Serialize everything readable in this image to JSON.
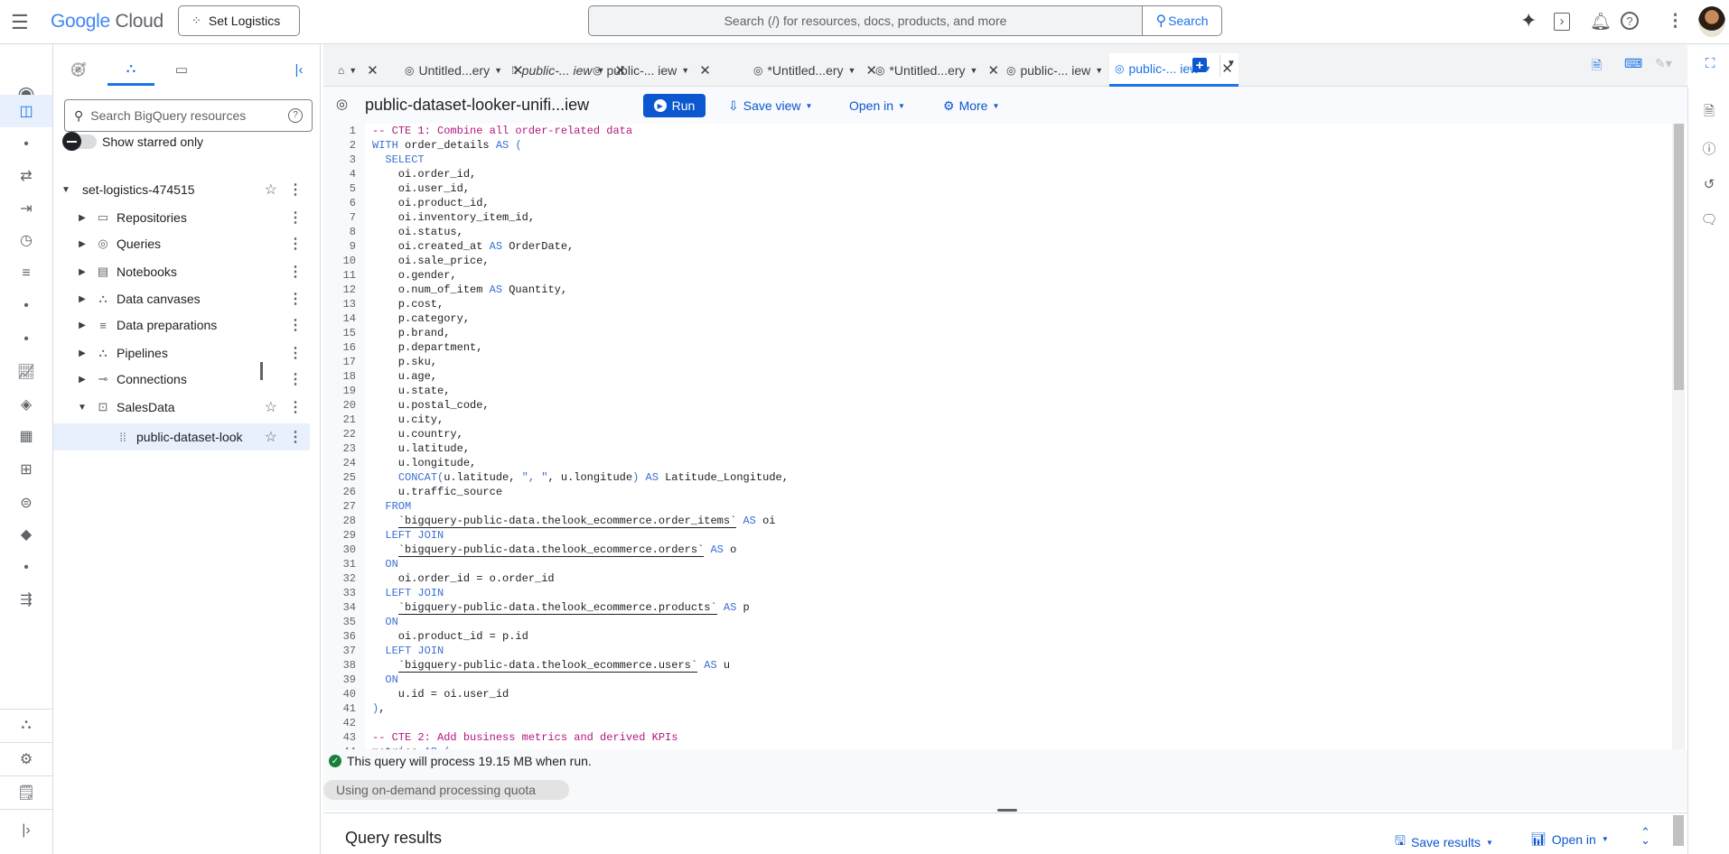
{
  "header": {
    "logo": {
      "google": "Google",
      "cloud": "Cloud"
    },
    "project": "Set Logistics",
    "search_placeholder": "Search (/) for resources, docs, products, and more",
    "search_button": "Search"
  },
  "explorer": {
    "search_placeholder": "Search BigQuery resources",
    "show_starred": "Show starred only",
    "tree": [
      {
        "label": "set-logistics-474515",
        "icon": "project",
        "expanded": true
      },
      {
        "label": "Repositories",
        "icon": "repo"
      },
      {
        "label": "Queries",
        "icon": "query"
      },
      {
        "label": "Notebooks",
        "icon": "notebook"
      },
      {
        "label": "Data canvases",
        "icon": "canvas"
      },
      {
        "label": "Data preparations",
        "icon": "prep"
      },
      {
        "label": "Pipelines",
        "icon": "pipeline"
      },
      {
        "label": "Connections",
        "icon": "connection"
      },
      {
        "label": "SalesData",
        "icon": "dataset",
        "expanded": true
      },
      {
        "label": "public-dataset-look",
        "icon": "view",
        "selected": true
      }
    ]
  },
  "tabs": [
    {
      "label": "",
      "icon": "home"
    },
    {
      "label": "Untitled...ery",
      "icon": "query"
    },
    {
      "label": "public-... iew",
      "icon": "view",
      "italic": true
    },
    {
      "label": "public-... iew",
      "icon": "query"
    },
    {
      "label": "*Untitled...ery",
      "icon": "query"
    },
    {
      "label": "*Untitled...ery",
      "icon": "query"
    },
    {
      "label": "public-... iew",
      "icon": "query"
    },
    {
      "label": "public-... iew",
      "icon": "query",
      "active": true
    }
  ],
  "toolbar": {
    "title": "public-dataset-looker-unifi...iew",
    "run": "Run",
    "save_view": "Save view",
    "open_in": "Open in",
    "more": "More"
  },
  "code_lines": [
    [
      [
        "cm",
        "-- CTE 1: Combine all order-related data"
      ]
    ],
    [
      [
        "kw",
        "WITH"
      ],
      [
        "t",
        " order_details "
      ],
      [
        "kw",
        "AS"
      ],
      [
        "t",
        " "
      ],
      [
        "br",
        "("
      ]
    ],
    [
      [
        "t",
        "  "
      ],
      [
        "kw",
        "SELECT"
      ]
    ],
    [
      [
        "t",
        "    oi.order_id,"
      ]
    ],
    [
      [
        "t",
        "    oi.user_id,"
      ]
    ],
    [
      [
        "t",
        "    oi.product_id,"
      ]
    ],
    [
      [
        "t",
        "    oi.inventory_item_id,"
      ]
    ],
    [
      [
        "t",
        "    oi.status,"
      ]
    ],
    [
      [
        "t",
        "    oi.created_at "
      ],
      [
        "kw",
        "AS"
      ],
      [
        "t",
        " OrderDate,"
      ]
    ],
    [
      [
        "t",
        "    oi.sale_price,"
      ]
    ],
    [
      [
        "t",
        "    o.gender,"
      ]
    ],
    [
      [
        "t",
        "    o.num_of_item "
      ],
      [
        "kw",
        "AS"
      ],
      [
        "t",
        " Quantity,"
      ]
    ],
    [
      [
        "t",
        "    p.cost,"
      ]
    ],
    [
      [
        "t",
        "    p.category,"
      ]
    ],
    [
      [
        "t",
        "    p.brand,"
      ]
    ],
    [
      [
        "t",
        "    p.department,"
      ]
    ],
    [
      [
        "t",
        "    p.sku,"
      ]
    ],
    [
      [
        "t",
        "    u.age,"
      ]
    ],
    [
      [
        "t",
        "    u.state,"
      ]
    ],
    [
      [
        "t",
        "    u.postal_code,"
      ]
    ],
    [
      [
        "t",
        "    u.city,"
      ]
    ],
    [
      [
        "t",
        "    u.country,"
      ]
    ],
    [
      [
        "t",
        "    u.latitude,"
      ]
    ],
    [
      [
        "t",
        "    u.longitude,"
      ]
    ],
    [
      [
        "t",
        "    "
      ],
      [
        "kw",
        "CONCAT"
      ],
      [
        "br",
        "("
      ],
      [
        "t",
        "u.latitude, "
      ],
      [
        "str",
        "\", \""
      ],
      [
        "t",
        ", u.longitude"
      ],
      [
        "br",
        ")"
      ],
      [
        "t",
        " "
      ],
      [
        "kw",
        "AS"
      ],
      [
        "t",
        " Latitude_Longitude,"
      ]
    ],
    [
      [
        "t",
        "    u.traffic_source"
      ]
    ],
    [
      [
        "t",
        "  "
      ],
      [
        "kw",
        "FROM"
      ]
    ],
    [
      [
        "t",
        "    "
      ],
      [
        "tbl",
        "`bigquery-public-data.thelook_ecommerce.order_items`"
      ],
      [
        "t",
        " "
      ],
      [
        "kw",
        "AS"
      ],
      [
        "t",
        " oi"
      ]
    ],
    [
      [
        "t",
        "  "
      ],
      [
        "kw",
        "LEFT JOIN"
      ]
    ],
    [
      [
        "t",
        "    "
      ],
      [
        "tbl",
        "`bigquery-public-data.thelook_ecommerce.orders`"
      ],
      [
        "t",
        " "
      ],
      [
        "kw",
        "AS"
      ],
      [
        "t",
        " o"
      ]
    ],
    [
      [
        "t",
        "  "
      ],
      [
        "kw",
        "ON"
      ]
    ],
    [
      [
        "t",
        "    oi.order_id = o.order_id"
      ]
    ],
    [
      [
        "t",
        "  "
      ],
      [
        "kw",
        "LEFT JOIN"
      ]
    ],
    [
      [
        "t",
        "    "
      ],
      [
        "tbl",
        "`bigquery-public-data.thelook_ecommerce.products`"
      ],
      [
        "t",
        " "
      ],
      [
        "kw",
        "AS"
      ],
      [
        "t",
        " p"
      ]
    ],
    [
      [
        "t",
        "  "
      ],
      [
        "kw",
        "ON"
      ]
    ],
    [
      [
        "t",
        "    oi.product_id = p.id"
      ]
    ],
    [
      [
        "t",
        "  "
      ],
      [
        "kw",
        "LEFT JOIN"
      ]
    ],
    [
      [
        "t",
        "    "
      ],
      [
        "tbl",
        "`bigquery-public-data.thelook_ecommerce.users`"
      ],
      [
        "t",
        " "
      ],
      [
        "kw",
        "AS"
      ],
      [
        "t",
        " u"
      ]
    ],
    [
      [
        "t",
        "  "
      ],
      [
        "kw",
        "ON"
      ]
    ],
    [
      [
        "t",
        "    u.id = oi.user_id"
      ]
    ],
    [
      [
        "br",
        ")"
      ],
      [
        "t",
        ","
      ]
    ],
    [
      [
        "t",
        ""
      ]
    ],
    [
      [
        "cm",
        "-- CTE 2: Add business metrics and derived KPIs"
      ]
    ],
    [
      [
        "t",
        "metrics "
      ],
      [
        "kw",
        "AS"
      ],
      [
        "t",
        " "
      ],
      [
        "br",
        "("
      ]
    ]
  ],
  "status": {
    "message": "This query will process 19.15 MB when run.",
    "quota": "Using on-demand processing quota"
  },
  "results": {
    "title": "Query results",
    "save_results": "Save results",
    "open_in": "Open in"
  },
  "colors": {
    "accent": "#0b57d0",
    "ok": "#188038",
    "comment": "#b3157f",
    "keyword": "#3b6fd4"
  }
}
